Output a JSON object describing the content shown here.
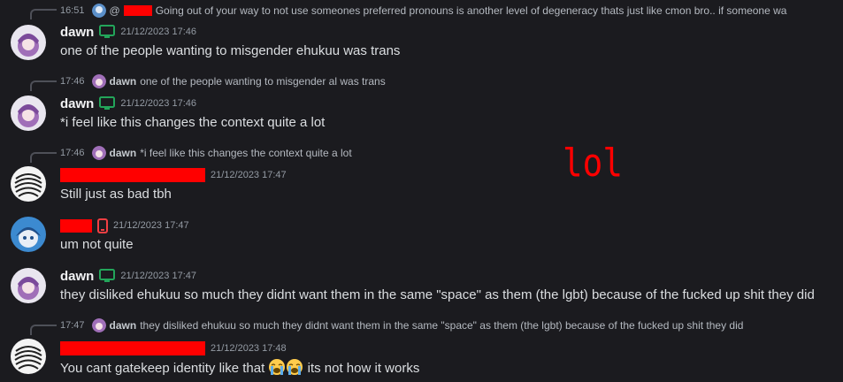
{
  "reply_top": {
    "time": "16:51",
    "mention": "@",
    "text": "Going out of your way to not use someones preferred pronouns is another level of degeneracy thats just like cmon bro..  if someone wa"
  },
  "messages": [
    {
      "author": "dawn",
      "timestamp": "21/12/2023 17:46",
      "text": "one of the people wanting to misgender ehukuu was trans"
    },
    {
      "reply": {
        "time": "17:46",
        "author": "dawn",
        "text": "one of the people wanting to misgender al was trans"
      },
      "author": "dawn",
      "timestamp": "21/12/2023 17:46",
      "text": "*i feel like this changes the context quite a lot"
    },
    {
      "reply": {
        "time": "17:46",
        "author": "dawn",
        "text": "*i feel like this changes the context quite a lot"
      },
      "timestamp": "21/12/2023 17:47",
      "text": "Still just as bad tbh"
    },
    {
      "timestamp": "21/12/2023 17:47",
      "text": "um not quite"
    },
    {
      "author": "dawn",
      "timestamp": "21/12/2023 17:47",
      "text": "they disliked ehukuu so much they didnt want them in the same \"space\" as them (the lgbt) because of the fucked up shit they did"
    },
    {
      "reply": {
        "time": "17:47",
        "author": "dawn",
        "text": "they disliked ehukuu so much they didnt want them in the same \"space\" as them (the lgbt) because of the fucked up shit they did"
      },
      "timestamp": "21/12/2023 17:48",
      "text_before": "You cant gatekeep identity like that",
      "text_after": " its not how it works"
    }
  ],
  "annotation": "lol",
  "colors": {
    "redact": "#ff0000",
    "desktop_icon": "#23a55a",
    "mobile_icon": "#f23f43"
  }
}
